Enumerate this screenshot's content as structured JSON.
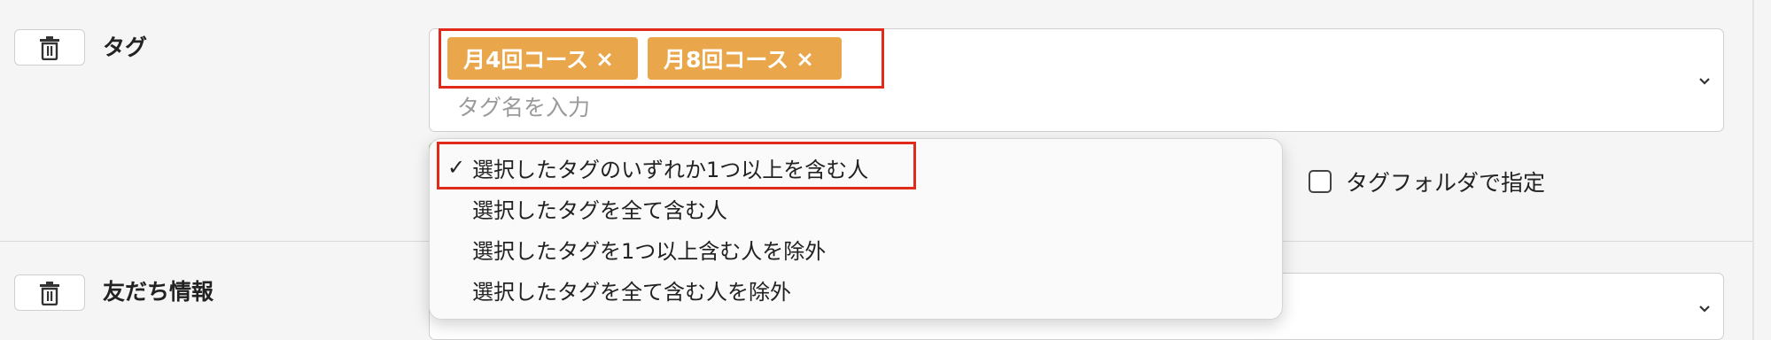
{
  "tag_section": {
    "label": "タグ",
    "selected_tags": [
      {
        "label": "月4回コース",
        "remove": "×"
      },
      {
        "label": "月8回コース",
        "remove": "×"
      }
    ],
    "input_placeholder": "タグ名を入力",
    "folder_checkbox": {
      "label": "タグフォルダで指定",
      "checked": false
    }
  },
  "match_dropdown": {
    "selected_index": 0,
    "check_mark": "✓",
    "options": [
      "選択したタグのいずれか1つ以上を含む人",
      "選択したタグを全て含む人",
      "選択したタグを1つ以上含む人を除外",
      "選択したタグを全て含む人を除外"
    ]
  },
  "friend_section": {
    "label": "友だち情報"
  },
  "icons": {
    "delete": "trash-icon",
    "expand": "chevron-down-icon"
  },
  "colors": {
    "chip": "#eaa64a",
    "highlight": "#e02b1a",
    "valid_border": "#7fc463"
  }
}
